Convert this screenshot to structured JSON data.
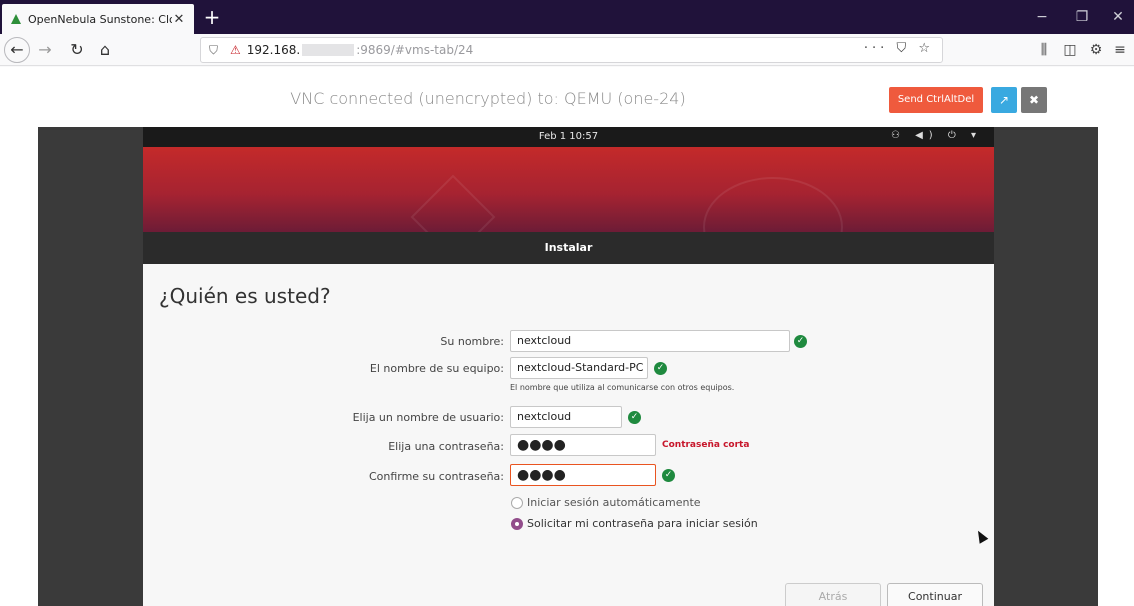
{
  "browser": {
    "tab_title": "OpenNebula Sunstone: Cloud",
    "tab_close": "✕",
    "new_tab": "+",
    "url_host": "192.168.",
    "url_path": ":9869/#vms-tab/24",
    "url_actions": "··· ⛉ ☆",
    "window_controls": [
      "−",
      "❐",
      "✕"
    ],
    "toolbar_icons": [
      "library-icon",
      "sidebar-icon",
      "extension-icon",
      "menu-icon"
    ]
  },
  "vnc": {
    "status": "VNC connected (unencrypted) to: QEMU (one-24)",
    "send_cad_label": "Send CtrlAltDel",
    "open_label": "↗",
    "close_label": "✖"
  },
  "ubuntu": {
    "clock": "Feb 1  10:57",
    "tray": "⚇ ◀) ⏻ ▾",
    "installer_title": "Instalar",
    "heading": "¿Quién es usted?",
    "form": {
      "name_label": "Su nombre:",
      "name_value": "nextcloud",
      "computer_label": "El nombre de su equipo:",
      "computer_value": "nextcloud-Standard-PC",
      "computer_hint": "El nombre que utiliza al comunicarse con otros equipos.",
      "username_label": "Elija un nombre de usuario:",
      "username_value": "nextcloud",
      "password_label": "Elija una contraseña:",
      "password_value": "●●●●",
      "password_warning": "Contraseña corta",
      "confirm_label": "Confirme su contraseña:",
      "confirm_value": "●●●●",
      "auto_login_label": "Iniciar sesión automáticamente",
      "require_password_label": "Solicitar mi contraseña para iniciar sesión"
    },
    "back_label": "Atrás",
    "continue_label": "Continuar"
  },
  "colors": {
    "browser_tabbar": "#20123a",
    "cad_button": "#ef5a3d",
    "open_button": "#39a9e0",
    "ok_check": "#1f8a3f",
    "warning": "#c7162b",
    "radio_selected": "#924d8b",
    "focus_border": "#e95420"
  }
}
